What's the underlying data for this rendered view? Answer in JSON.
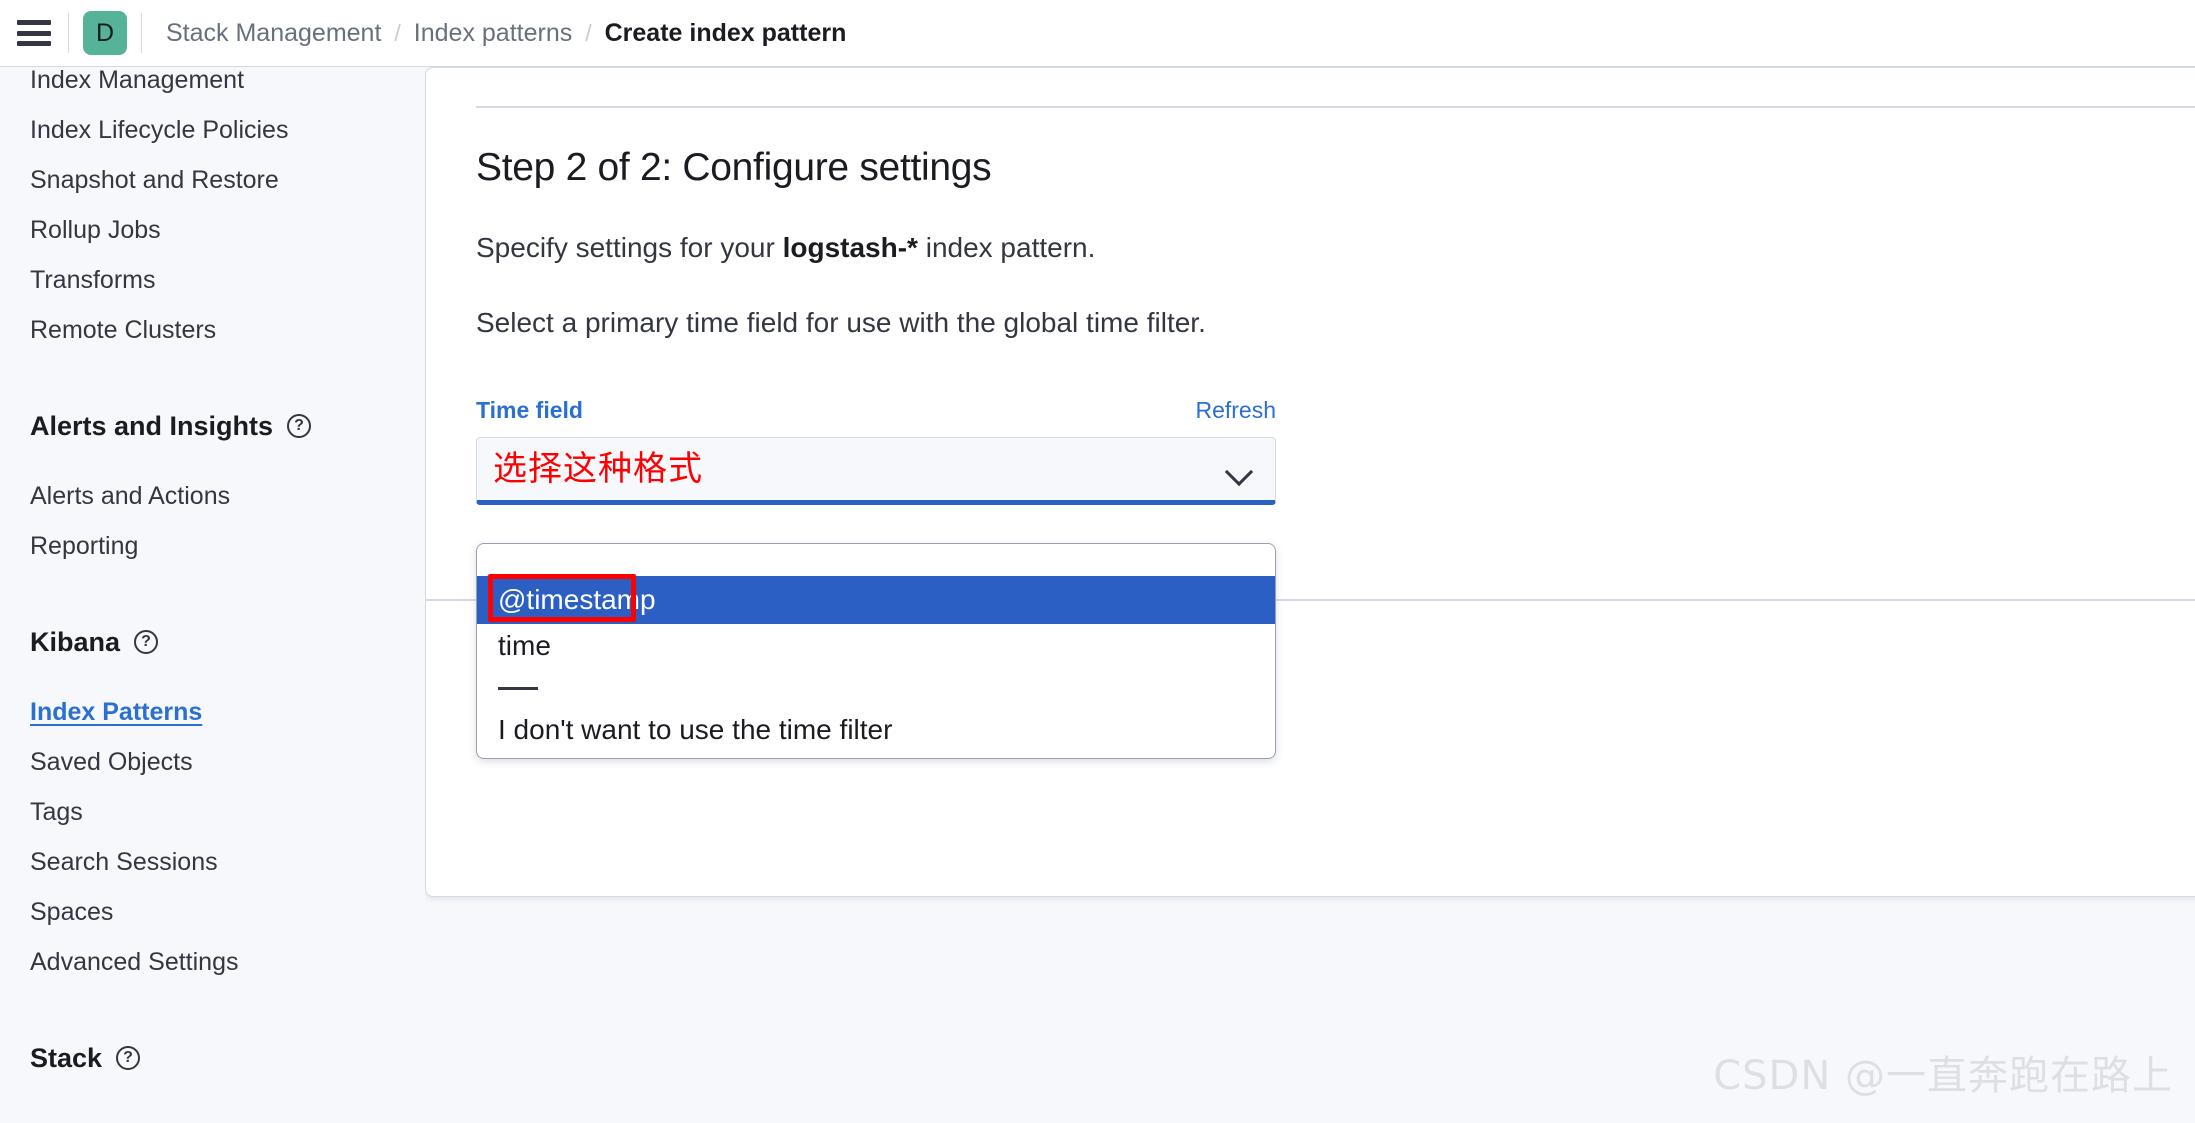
{
  "header": {
    "menu_icon": "hamburger-menu-icon",
    "logo_initial": "D",
    "breadcrumbs": [
      {
        "label": "Stack Management",
        "current": false
      },
      {
        "label": "Index patterns",
        "current": false
      },
      {
        "label": "Create index pattern",
        "current": true
      }
    ],
    "separator": "/"
  },
  "sidebar": {
    "top_items": [
      {
        "label": "Index Management"
      },
      {
        "label": "Index Lifecycle Policies"
      },
      {
        "label": "Snapshot and Restore"
      },
      {
        "label": "Rollup Jobs"
      },
      {
        "label": "Transforms"
      },
      {
        "label": "Remote Clusters"
      }
    ],
    "groups": [
      {
        "title": "Alerts and Insights",
        "help_icon": "question-circle-icon",
        "items": [
          {
            "label": "Alerts and Actions",
            "active": false
          },
          {
            "label": "Reporting",
            "active": false
          }
        ]
      },
      {
        "title": "Kibana",
        "help_icon": "question-circle-icon",
        "items": [
          {
            "label": "Index Patterns",
            "active": true
          },
          {
            "label": "Saved Objects",
            "active": false
          },
          {
            "label": "Tags",
            "active": false
          },
          {
            "label": "Search Sessions",
            "active": false
          },
          {
            "label": "Spaces",
            "active": false
          },
          {
            "label": "Advanced Settings",
            "active": false
          }
        ]
      },
      {
        "title": "Stack",
        "help_icon": "question-circle-icon",
        "items": []
      }
    ]
  },
  "main": {
    "step_title": "Step 2 of 2: Configure settings",
    "description_prefix": "Specify settings for your ",
    "description_pattern": "logstash-*",
    "description_suffix": " index pattern.",
    "instruction": "Select a primary time field for use with the global time filter.",
    "time_field": {
      "label": "Time field",
      "refresh_label": "Refresh",
      "selected_value": "选择这种格式",
      "chevron_icon": "chevron-down-icon",
      "options": [
        {
          "label": "",
          "type": "blank"
        },
        {
          "label": "@timestamp",
          "type": "option",
          "selected": true
        },
        {
          "label": "time",
          "type": "option",
          "selected": false
        },
        {
          "label": "",
          "type": "separator"
        },
        {
          "label": "I don't want to use the time filter",
          "type": "option",
          "selected": false
        }
      ]
    }
  },
  "watermark": {
    "text": "CSDN @一直奔跑在路上"
  },
  "colors": {
    "accent_blue": "#2B6FD4",
    "selected_blue": "#2B5FC4",
    "annotation_red": "#FF0000",
    "logo_teal": "#54B399",
    "page_bg": "#F7F8FC",
    "border": "#D3DAE6"
  }
}
